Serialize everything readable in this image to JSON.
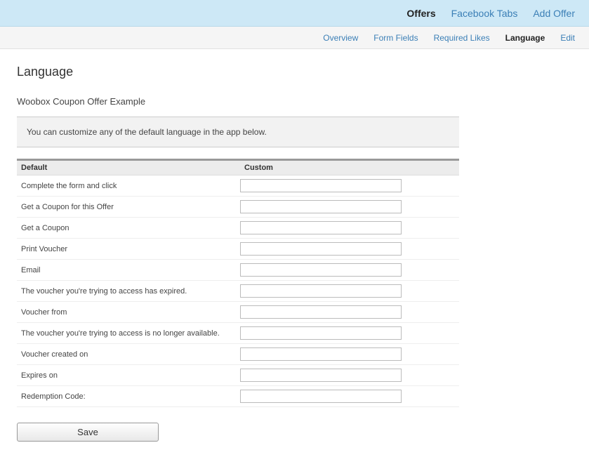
{
  "topnav": {
    "items": [
      {
        "label": "Offers",
        "active": true
      },
      {
        "label": "Facebook Tabs",
        "active": false
      },
      {
        "label": "Add Offer",
        "active": false
      }
    ]
  },
  "subnav": {
    "items": [
      {
        "label": "Overview",
        "active": false
      },
      {
        "label": "Form Fields",
        "active": false
      },
      {
        "label": "Required Likes",
        "active": false
      },
      {
        "label": "Language",
        "active": true
      },
      {
        "label": "Edit",
        "active": false
      }
    ]
  },
  "page": {
    "title": "Language",
    "subtitle": "Woobox Coupon Offer Example",
    "info": "You can customize any of the default language in the app below."
  },
  "table": {
    "headers": {
      "default": "Default",
      "custom": "Custom"
    },
    "rows": [
      {
        "default": "Complete the form and click",
        "custom": ""
      },
      {
        "default": "Get a Coupon for this Offer",
        "custom": ""
      },
      {
        "default": "Get a Coupon",
        "custom": ""
      },
      {
        "default": "Print Voucher",
        "custom": ""
      },
      {
        "default": "Email",
        "custom": ""
      },
      {
        "default": "The voucher you're trying to access has expired.",
        "custom": ""
      },
      {
        "default": "Voucher from",
        "custom": ""
      },
      {
        "default": "The voucher you're trying to access is no longer available.",
        "custom": ""
      },
      {
        "default": "Voucher created on",
        "custom": ""
      },
      {
        "default": "Expires on",
        "custom": ""
      },
      {
        "default": "Redemption Code:",
        "custom": ""
      }
    ]
  },
  "buttons": {
    "save": "Save"
  }
}
